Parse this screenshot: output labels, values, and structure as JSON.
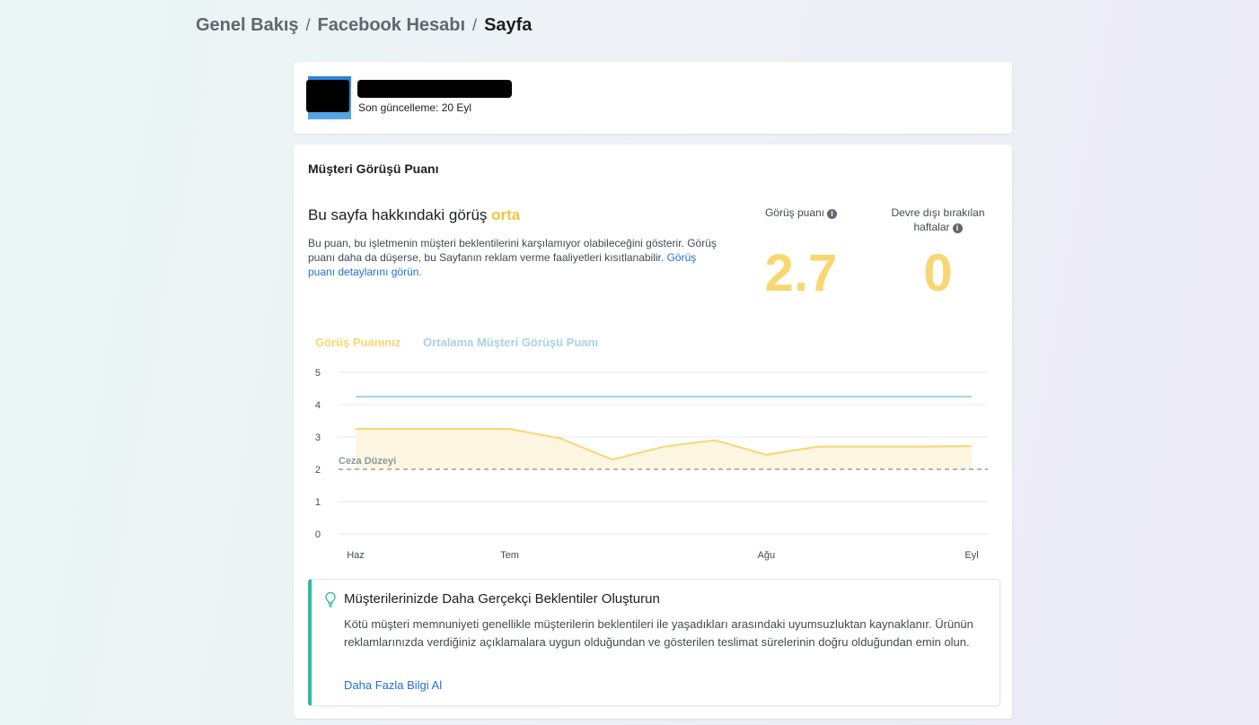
{
  "breadcrumb": {
    "items": [
      "Genel Bakış",
      "Facebook Hesabı",
      "Sayfa"
    ],
    "separator": "/"
  },
  "page": {
    "last_updated": "Son güncelleme: 20 Eyl"
  },
  "score_section": {
    "title": "Müşteri Görüşü Puanı",
    "headline_prefix": "Bu sayfa hakkındaki görüş",
    "headline_level": "orta",
    "description": "Bu puan, bu işletmenin müşteri beklentilerini karşılamıyor olabileceğini gösterir. Görüş puanı daha da düşerse, bu Sayfanın reklam verme faaliyetleri kısıtlanabilir.",
    "description_link": "Görüş puanı detaylarını görün.",
    "score_label": "Görüş puanı",
    "score_value": "2.7",
    "weeks_label_line1": "Devre dışı bırakılan",
    "weeks_label_line2": "haftalar",
    "weeks_value": "0"
  },
  "legend": {
    "yours": "Görüş Puanınız",
    "average": "Ortalama Müşteri Görüşü Puanı"
  },
  "chart_data": {
    "type": "line",
    "x": [
      "Haz",
      "",
      "",
      "Tem",
      "",
      "",
      "",
      "",
      "Ağu",
      "",
      "",
      "",
      "Eyl"
    ],
    "x_tick_labels": [
      {
        "label": "Haz",
        "x": 0
      },
      {
        "label": "Tem",
        "x": 3
      },
      {
        "label": "Ağu",
        "x": 8
      },
      {
        "label": "Eyl",
        "x": 12
      }
    ],
    "series": [
      {
        "name": "Görüş Puanınız",
        "color": "#f8d671",
        "values": [
          3.25,
          3.25,
          3.25,
          3.25,
          2.95,
          2.3,
          2.7,
          2.9,
          2.45,
          2.7,
          2.7,
          2.7,
          2.72
        ]
      },
      {
        "name": "Ortalama Müşteri Görüşü Puanı",
        "color": "#a7d3e4",
        "values": [
          4.25,
          4.25,
          4.25,
          4.25,
          4.25,
          4.25,
          4.25,
          4.25,
          4.25,
          4.25,
          4.25,
          4.25,
          4.25
        ]
      }
    ],
    "threshold": {
      "label": "Ceza Düzeyi",
      "value": 2
    },
    "ylim": [
      0,
      5
    ],
    "y_ticks": [
      0,
      1,
      2,
      3,
      4,
      5
    ],
    "grid": true
  },
  "tip": {
    "title": "Müşterilerinizde Daha Gerçekçi Beklentiler Oluşturun",
    "body": "Kötü müşteri memnuniyeti genellikle müşterilerin beklentileri ile yaşadıkları arasındaki uyumsuzluktan kaynaklanır. Ürünün reklamlarınızda verdiğiniz açıklamalara uygun olduğundan ve gösterilen teslimat sürelerinin doğru olduğundan emin olun.",
    "link": "Daha Fazla Bilgi Al",
    "icon": "lightbulb-icon",
    "accent": "#2abba7"
  },
  "colors": {
    "score": "#f8d671",
    "average": "#a7d3e4",
    "link": "#216fdb"
  }
}
